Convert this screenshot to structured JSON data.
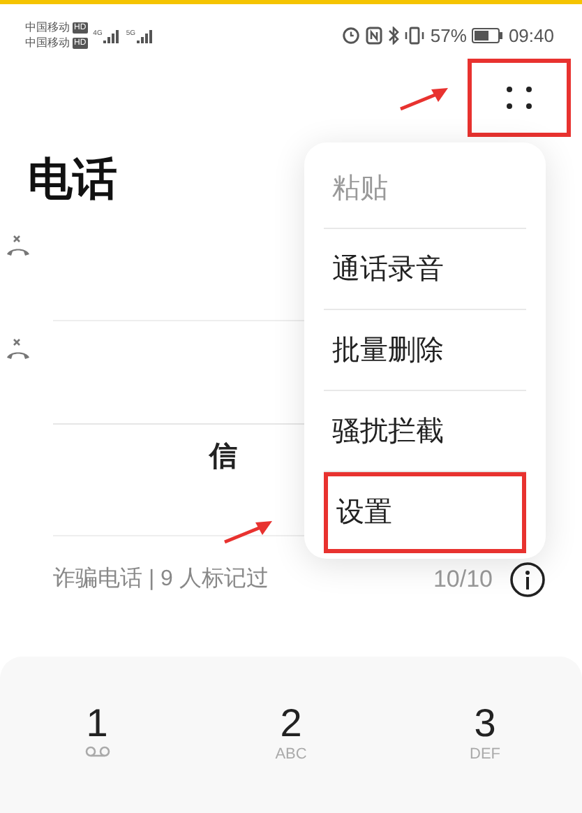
{
  "status_bar": {
    "carriers": [
      {
        "name": "中国移动",
        "badge": "HD"
      },
      {
        "name": "中国移动",
        "badge": "HD"
      }
    ],
    "signals": [
      {
        "type": "4G"
      },
      {
        "type": "5G"
      }
    ],
    "battery_text": "57%",
    "battery": {
      "level": 0.57
    },
    "time": "09:40"
  },
  "toolbar": {
    "more_button_highlighted": true
  },
  "title": "电话",
  "calls": [
    {
      "missed": true
    },
    {
      "missed": true
    }
  ],
  "fragment": "信",
  "sim_row": {
    "label": "诈骗电话 | 9 人标记过",
    "count": "10/10"
  },
  "menu": [
    {
      "label": "粘贴",
      "disabled": true,
      "highlighted": false
    },
    {
      "label": "通话录音",
      "disabled": false,
      "highlighted": false
    },
    {
      "label": "批量删除",
      "disabled": false,
      "highlighted": false
    },
    {
      "label": "骚扰拦截",
      "disabled": false,
      "highlighted": false
    },
    {
      "label": "设置",
      "disabled": false,
      "highlighted": true
    }
  ],
  "keypad": [
    {
      "digit": "1",
      "kind": "voicemail"
    },
    {
      "digit": "2",
      "kind": "letters",
      "sub": "ABC"
    },
    {
      "digit": "3",
      "kind": "letters",
      "sub": "DEF"
    }
  ]
}
